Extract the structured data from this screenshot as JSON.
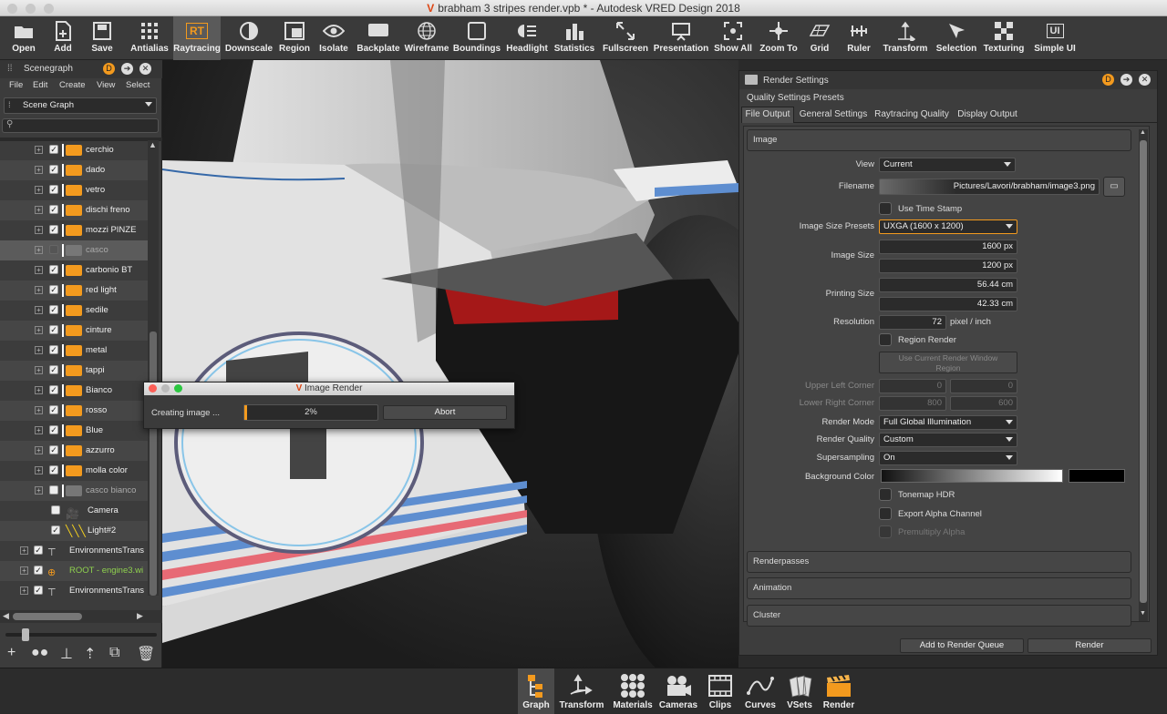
{
  "window": {
    "title": "brabham 3 stripes render.vpb * - Autodesk VRED Design 2018"
  },
  "toolbar": {
    "items": [
      {
        "name": "open",
        "label": "Open"
      },
      {
        "name": "add",
        "label": "Add"
      },
      {
        "name": "save",
        "label": "Save"
      },
      {
        "name": "antialias",
        "label": "Antialias"
      },
      {
        "name": "raytracing",
        "label": "Raytracing",
        "icon_text": "RT"
      },
      {
        "name": "downscale",
        "label": "Downscale"
      },
      {
        "name": "region",
        "label": "Region"
      },
      {
        "name": "isolate",
        "label": "Isolate"
      },
      {
        "name": "backplate",
        "label": "Backplate"
      },
      {
        "name": "wireframe",
        "label": "Wireframe"
      },
      {
        "name": "boundings",
        "label": "Boundings"
      },
      {
        "name": "headlight",
        "label": "Headlight"
      },
      {
        "name": "statistics",
        "label": "Statistics"
      },
      {
        "name": "fullscreen",
        "label": "Fullscreen"
      },
      {
        "name": "presentation",
        "label": "Presentation"
      },
      {
        "name": "show-all",
        "label": "Show All"
      },
      {
        "name": "zoom-to",
        "label": "Zoom To"
      },
      {
        "name": "grid",
        "label": "Grid"
      },
      {
        "name": "ruler",
        "label": "Ruler"
      },
      {
        "name": "transform",
        "label": "Transform"
      },
      {
        "name": "selection",
        "label": "Selection"
      },
      {
        "name": "texturing",
        "label": "Texturing"
      },
      {
        "name": "simple-ui",
        "label": "Simple UI",
        "icon_text": "UI"
      }
    ]
  },
  "scenegraph": {
    "title": "Scenegraph",
    "menu": [
      "File",
      "Edit",
      "Create",
      "View",
      "Select"
    ],
    "dropdown": "Scene Graph",
    "search_placeholder": "",
    "rows": [
      "cerchio",
      "dado",
      "vetro",
      "dischi freno",
      "mozzi  PINZE",
      "casco",
      "carbonio BT",
      "red light",
      "sedile",
      "cinture",
      "metal",
      "tappi",
      "Bianco",
      "rosso",
      "Blue",
      "azzurro",
      "molla color",
      "casco bianco",
      "Camera",
      "Light#2"
    ],
    "bottom_rows": [
      "EnvironmentsTrans",
      "ROOT - engine3.wi",
      "EnvironmentsTrans"
    ]
  },
  "image_render": {
    "title": "Image Render",
    "status": "Creating image ...",
    "progress_text": "2%",
    "progress": 0.02,
    "abort_label": "Abort"
  },
  "render_settings": {
    "title": "Render Settings",
    "presets": "Quality Settings Presets",
    "tabs": [
      "File Output",
      "General Settings",
      "Raytracing Quality",
      "Display Output"
    ],
    "section_image": "Image",
    "view_label": "View",
    "view_value": "Current",
    "filename_label": "Filename",
    "filename_value": "Pictures/Lavori/brabham/image3.png",
    "timestamp_label": "Use Time Stamp",
    "presets_label": "Image Size Presets",
    "presets_value": "UXGA (1600 x 1200)",
    "size_label": "Image Size",
    "width": "1600 px",
    "height": "1200 px",
    "printing_label": "Printing Size",
    "print_w": "56.44 cm",
    "print_h": "42.33 cm",
    "resolution_label": "Resolution",
    "resolution_value": "72",
    "resolution_unit": "pixel / inch",
    "region_label": "Region Render",
    "use_region_btn": "Use Current Render Window Region",
    "ulc_label": "Upper Left Corner",
    "ulc_x": "0",
    "ulc_y": "0",
    "lrc_label": "Lower Right Corner",
    "lrc_x": "800",
    "lrc_y": "600",
    "mode_label": "Render Mode",
    "mode_value": "Full Global Illumination",
    "quality_label": "Render Quality",
    "quality_value": "Custom",
    "ss_label": "Supersampling",
    "ss_value": "On",
    "bg_label": "Background Color",
    "tonemap_label": "Tonemap HDR",
    "alpha_label": "Export Alpha Channel",
    "premult_label": "Premultiply Alpha",
    "sections": [
      "Renderpasses",
      "Animation",
      "Cluster"
    ],
    "queue_btn": "Add to Render Queue",
    "render_btn": "Render"
  },
  "dock": {
    "items": [
      {
        "name": "graph",
        "label": "Graph"
      },
      {
        "name": "transform",
        "label": "Transform"
      },
      {
        "name": "materials",
        "label": "Materials"
      },
      {
        "name": "cameras",
        "label": "Cameras"
      },
      {
        "name": "clips",
        "label": "Clips"
      },
      {
        "name": "curves",
        "label": "Curves"
      },
      {
        "name": "vsets",
        "label": "VSets"
      },
      {
        "name": "render",
        "label": "Render"
      }
    ]
  },
  "colors": {
    "accent": "#f39a1e",
    "vred_red": "#dd3311"
  }
}
